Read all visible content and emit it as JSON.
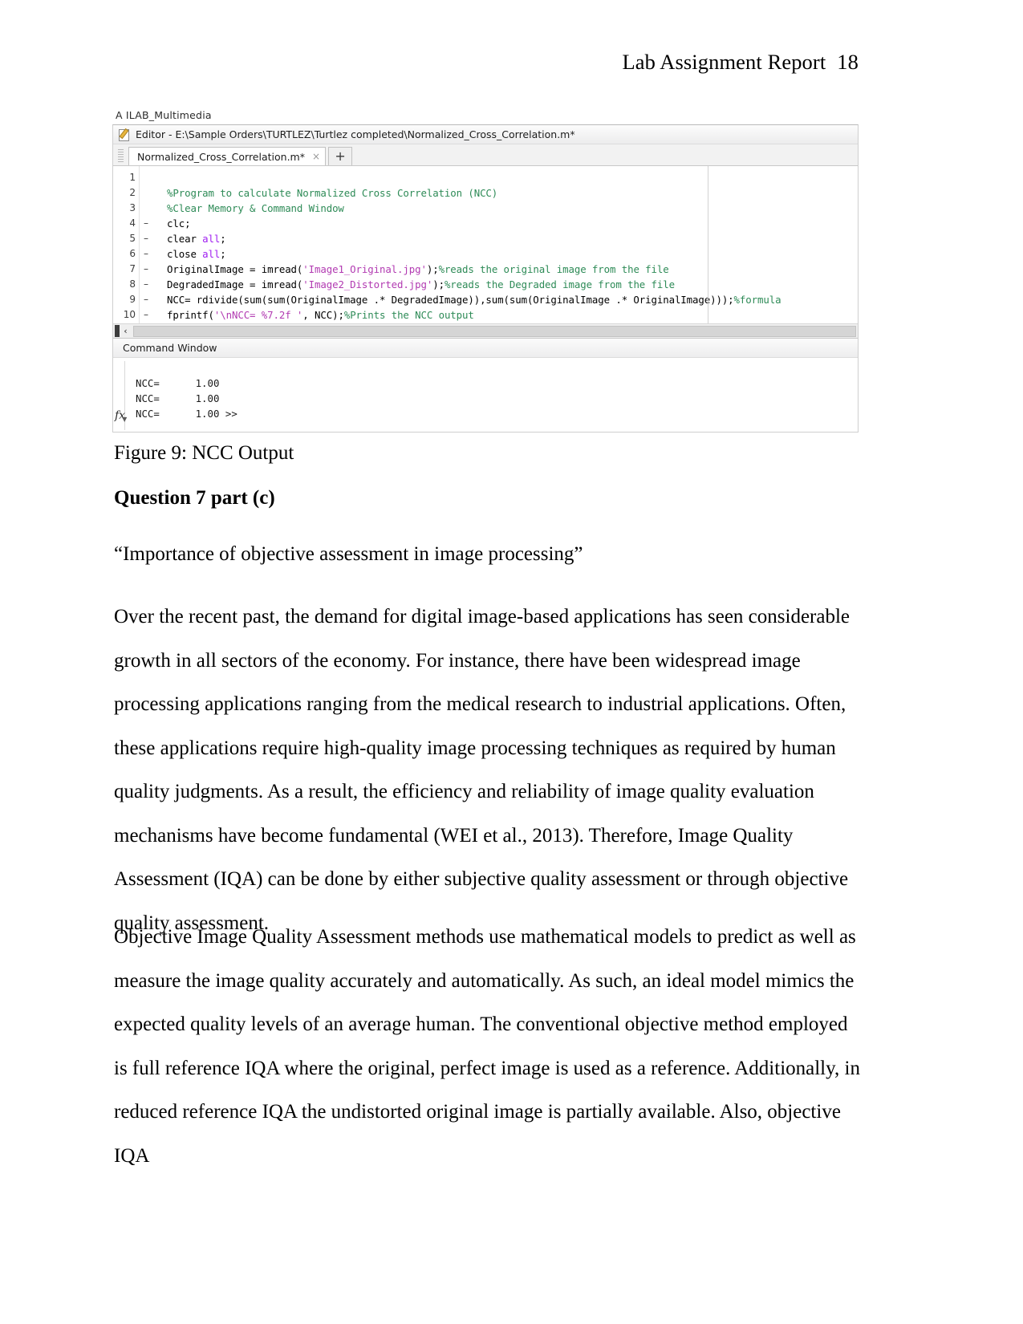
{
  "header": {
    "title": "Lab Assignment Report",
    "page_number": "18"
  },
  "figure": {
    "app_label": "A ILAB_Multimedia",
    "editor": {
      "titlebar": "Editor - E:\\Sample Orders\\TURTLEZ\\Turtlez completed\\Normalized_Cross_Correlation.m*",
      "tab_label": "Normalized_Cross_Correlation.m*",
      "tab_close": "×",
      "new_tab": "+",
      "line_numbers": [
        "1",
        "2",
        "3",
        "4",
        "5",
        "6",
        "7",
        "8",
        "9",
        "10"
      ],
      "breakpoints": [
        "",
        "",
        "",
        "–",
        "–",
        "–",
        "–",
        "–",
        "–",
        "–"
      ],
      "code": [
        "",
        "%Program to calculate Normalized Cross Correlation (NCC)",
        "%Clear Memory & Command Window",
        "clc;",
        "clear all;",
        "close all;",
        "OriginalImage = imread('Image1_Original.jpg');%reads the original image from the file",
        "DegradedImage = imread('Image2_Distorted.jpg');%reads the Degraded image from the file",
        "NCC= rdivide(sum(sum(OriginalImage .* DegradedImage)),sum(sum(OriginalImage .* OriginalImage)));%formula",
        "fprintf('\\nNCC= %7.2f ', NCC);%Prints the NCC output"
      ],
      "scroll_left_arrow": "‹"
    },
    "command_window": {
      "title": "Command Window",
      "fx_label": "fx",
      "lines": [
        "NCC=      1.00",
        "NCC=      1.00",
        "NCC=      1.00 >>"
      ]
    }
  },
  "caption": "Figure 9: NCC Output",
  "question_heading": "Question 7 part (c)",
  "quote": "“Importance of objective assessment in image processing”",
  "paragraphs": {
    "p1": "Over the recent past, the demand for digital image-based applications has seen considerable growth in all sectors of the economy. For instance, there have been widespread image processing applications ranging from the medical research to industrial applications. Often, these applications require high-quality image processing techniques as required by human quality judgments. As a result, the efficiency and reliability of image quality evaluation mechanisms have become fundamental (WEI et al., 2013). Therefore, Image Quality Assessment (IQA) can be done by either subjective quality assessment or through objective quality assessment.",
    "p2": "Objective Image Quality Assessment methods use mathematical models to predict as well as measure the image quality accurately and automatically. As such, an ideal model mimics the expected quality levels of an average human. The conventional objective method employed is full reference IQA where the original, perfect image is used as a reference. Additionally, in reduced reference IQA the undistorted original image is partially available. Also, objective IQA"
  },
  "colors": {
    "comment_green": "#2e8b57",
    "string_magenta": "#b23bb2",
    "keyword_purple": "#a020f0",
    "text_black": "#000000"
  }
}
